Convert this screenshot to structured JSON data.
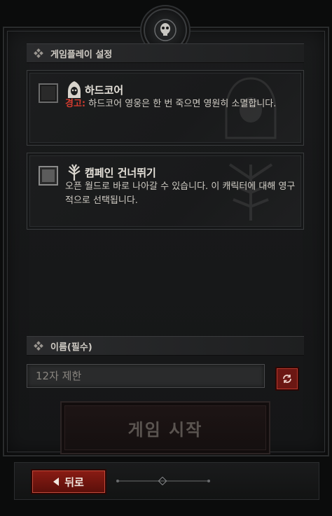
{
  "gameplay_settings": {
    "header": "게임플레이 설정",
    "options": [
      {
        "title": "하드코어",
        "warning_label": "경고:",
        "description": " 하드코어 영웅은 한 번 죽으면 영원히 소멸합니다.",
        "checked": false,
        "icon": "hooded-skull-icon"
      },
      {
        "title": "캠페인 건너뛰기",
        "description": "오픈 월드로 바로 나아갈 수 있습니다. 이 캐릭터에 대해 영구적으로 선택됩니다.",
        "checked": false,
        "icon": "tree-icon"
      }
    ]
  },
  "name_section": {
    "header": "이름(필수)",
    "input_value": "",
    "input_placeholder": "12자 제한",
    "random_icon": "refresh-icon"
  },
  "start_button": {
    "label": "게임 시작"
  },
  "back_button": {
    "label": "뒤로",
    "icon": "left-arrow-icon"
  },
  "colors": {
    "accent_red": "#8a1c14",
    "warning_red": "#d23b2f",
    "panel_bg": "#1a1b1c"
  }
}
